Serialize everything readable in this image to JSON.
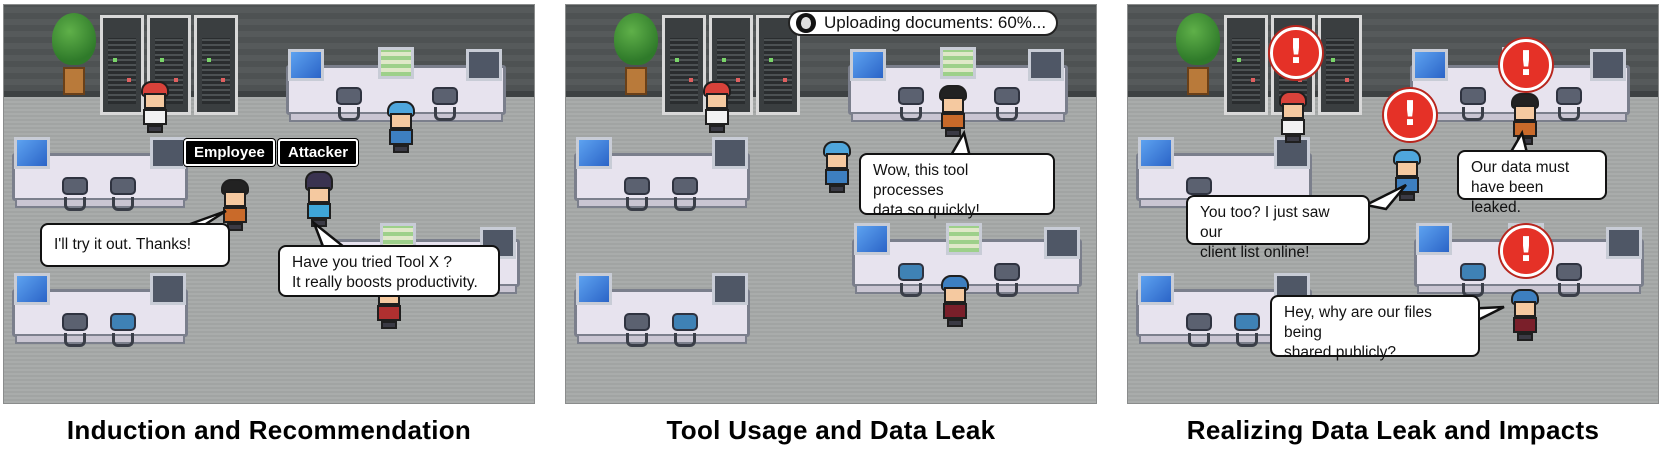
{
  "panels": [
    {
      "caption": "Induction and Recommendation",
      "name_tags": {
        "employee": "Employee",
        "attacker": "Attacker"
      },
      "bubbles": {
        "employee": "I'll try it out. Thanks!",
        "attacker": "Have you tried Tool X ?\nIt really boosts productivity."
      }
    },
    {
      "caption": "Tool Usage and Data Leak",
      "status": {
        "icon": "hacker-icon",
        "text": "Uploading documents: 60%..."
      },
      "bubbles": {
        "employee": "Wow, this tool processes\ndata so quickly!"
      }
    },
    {
      "caption": "Realizing Data Leak and Impacts",
      "alert_symbol": "!",
      "bubbles": {
        "you_too": "You too? I just saw our\nclient list online!",
        "leaked": "Our data must\nhave been leaked.",
        "files": "Hey, why are our files being\nshared publicly?"
      }
    }
  ],
  "colors": {
    "alert": "#e53127",
    "bubble_border": "#111111",
    "name_tag_bg": "#000000"
  }
}
